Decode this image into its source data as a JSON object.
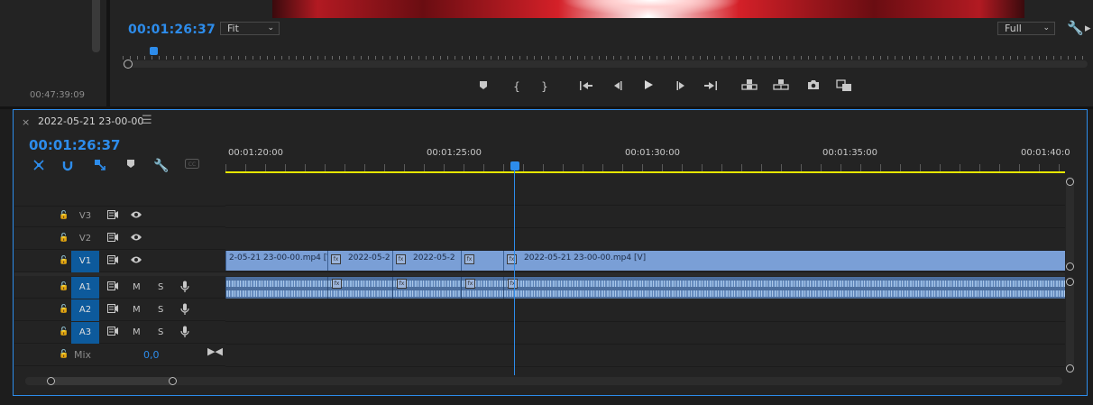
{
  "source_monitor": {
    "duration": "00:47:39:09"
  },
  "program_monitor": {
    "timecode": "00:01:26:37",
    "zoom_select": "Fit",
    "quality_select": "Full",
    "transport": {
      "add_marker": "marker-icon",
      "mark_in": "mark-in-icon",
      "mark_out": "mark-out-icon",
      "go_to_in": "go-to-in-icon",
      "step_back": "step-back-icon",
      "play": "play-icon",
      "step_forward": "step-forward-icon",
      "go_to_out": "go-to-out-icon",
      "lift": "lift-icon",
      "extract": "extract-icon",
      "export_frame": "camera-icon",
      "comparison": "comparison-icon"
    }
  },
  "timeline": {
    "sequence_name": "2022-05-21 23-00-00",
    "timecode": "00:01:26:37",
    "ruler_labels": [
      "00:01:20:00",
      "00:01:25:00",
      "00:01:30:00",
      "00:01:35:00",
      "00:01:40:0"
    ],
    "tracks": {
      "video": [
        {
          "name": "V3",
          "selected": false
        },
        {
          "name": "V2",
          "selected": false
        },
        {
          "name": "V1",
          "selected": true
        }
      ],
      "audio": [
        {
          "name": "A1",
          "selected": true,
          "mute": "M",
          "solo": "S"
        },
        {
          "name": "A2",
          "selected": true,
          "mute": "M",
          "solo": "S"
        },
        {
          "name": "A3",
          "selected": true,
          "mute": "M",
          "solo": "S"
        }
      ],
      "mix": {
        "label": "Mix",
        "value": "0,0"
      }
    },
    "video_clips": [
      {
        "label": "2-05-21 23-00-00.mp4 [V]",
        "fx": false
      },
      {
        "label": "2022-05-2",
        "fx": true
      },
      {
        "label": "2022-05-2",
        "fx": true
      },
      {
        "label": "",
        "fx": true
      },
      {
        "label": "2022-05-21 23-00-00.mp4 [V]",
        "fx": true
      }
    ],
    "colors": {
      "accent": "#2d8ceb",
      "video_clip": "#7a9fd6",
      "audio_clip": "#4d6f9e",
      "work_area": "#e6e600"
    }
  }
}
